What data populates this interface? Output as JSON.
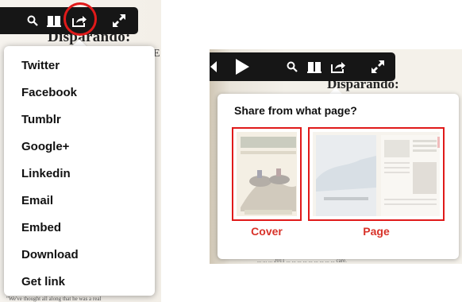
{
  "left_view": {
    "page_heading": "Disparando:",
    "edge_text": "E",
    "footer_snippet": "\"We've thought all along that he was a real",
    "share_menu": {
      "items": [
        {
          "label": "Twitter"
        },
        {
          "label": "Facebook"
        },
        {
          "label": "Tumblr"
        },
        {
          "label": "Google+"
        },
        {
          "label": "Linkedin"
        },
        {
          "label": "Email"
        },
        {
          "label": "Embed"
        },
        {
          "label": "Download"
        },
        {
          "label": "Get link"
        }
      ]
    },
    "toolbar_icons": [
      "search-icon",
      "book-icon",
      "share-icon",
      "fullscreen-icon"
    ]
  },
  "right_view": {
    "page_heading": "Disparando:",
    "toolbar_icons": [
      "previous-icon",
      "play-icon",
      "search-icon",
      "book-icon",
      "share-icon",
      "fullscreen-icon"
    ],
    "share_popup": {
      "title": "Share from what page?",
      "options": [
        {
          "label": "Cover"
        },
        {
          "label": "Page"
        }
      ]
    },
    "footer_snippet": "... ...  ... 2011 ... ...  ... ... ... ... ... ... ... care."
  },
  "colors": {
    "highlight_red": "#e01a1a",
    "label_red": "#d8332a",
    "toolbar_bg": "#161616",
    "paper": "#f4f1ea"
  }
}
